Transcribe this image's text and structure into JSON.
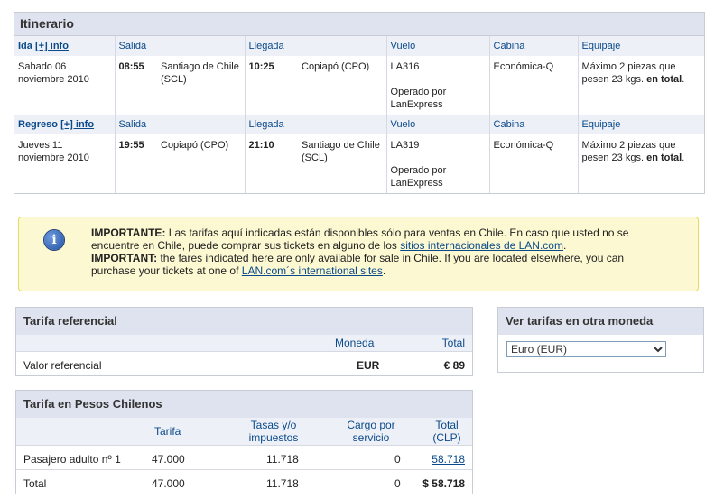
{
  "itinerary": {
    "title": "Itinerario",
    "outbound": {
      "label": "Ida",
      "info_link": "[+] info",
      "headers": [
        "Salida",
        "Llegada",
        "Vuelo",
        "Cabina",
        "Equipaje"
      ],
      "date": "Sabado 06 noviembre 2010",
      "dep_time": "08:55",
      "dep_place": "Santiago de Chile (SCL)",
      "arr_time": "10:25",
      "arr_place": "Copiapó (CPO)",
      "flight": "LA316",
      "operated": "Operado por LanExpress",
      "cabin": "Económica-Q",
      "baggage_pre": "Máximo 2 piezas que pesen 23 kgs.",
      "baggage_bold": "en total",
      "baggage_post": "."
    },
    "return": {
      "label": "Regreso",
      "info_link": "[+] info",
      "headers": [
        "Salida",
        "Llegada",
        "Vuelo",
        "Cabina",
        "Equipaje"
      ],
      "date": "Jueves 11 noviembre 2010",
      "dep_time": "19:55",
      "dep_place": "Copiapó (CPO)",
      "arr_time": "21:10",
      "arr_place": "Santiago de Chile (SCL)",
      "flight": "LA319",
      "operated": "Operado por LanExpress",
      "cabin": "Económica-Q",
      "baggage_pre": "Máximo 2 piezas que pesen 23 kgs.",
      "baggage_bold": "en total",
      "baggage_post": "."
    }
  },
  "notice": {
    "icon": "info-icon",
    "es_bold": "IMPORTANTE:",
    "es_text": "Las tarifas aquí indicadas están disponibles sólo para ventas en Chile. En caso que usted no se encuentre en Chile, puede comprar sus tickets en alguno de los",
    "es_link": "sitios internacionales de LAN.com",
    "es_end": ".",
    "en_bold": "IMPORTANT:",
    "en_text": "the fares indicated here are only available for sale in Chile. If you are located elsewhere, you can purchase your tickets at one of",
    "en_link": "LAN.com´s international sites",
    "en_end": "."
  },
  "reference_fare": {
    "title": "Tarifa referencial",
    "col_currency": "Moneda",
    "col_total": "Total",
    "row_label": "Valor referencial",
    "currency": "EUR",
    "total": "€ 89"
  },
  "clp_fare": {
    "title": "Tarifa en Pesos Chilenos",
    "col_fare": "Tarifa",
    "col_taxes": "Tasas y/o impuestos",
    "col_service": "Cargo por servicio",
    "col_total": "Total (CLP)",
    "rows": [
      {
        "label": "Pasajero adulto nº 1",
        "fare": "47.000",
        "taxes": "11.718",
        "service": "0",
        "total": "58.718"
      },
      {
        "label": "Total",
        "fare": "47.000",
        "taxes": "11.718",
        "service": "0",
        "total": "$ 58.718"
      }
    ]
  },
  "other_currency": {
    "title": "Ver tarifas en otra moneda",
    "selected": "Euro (EUR)"
  }
}
